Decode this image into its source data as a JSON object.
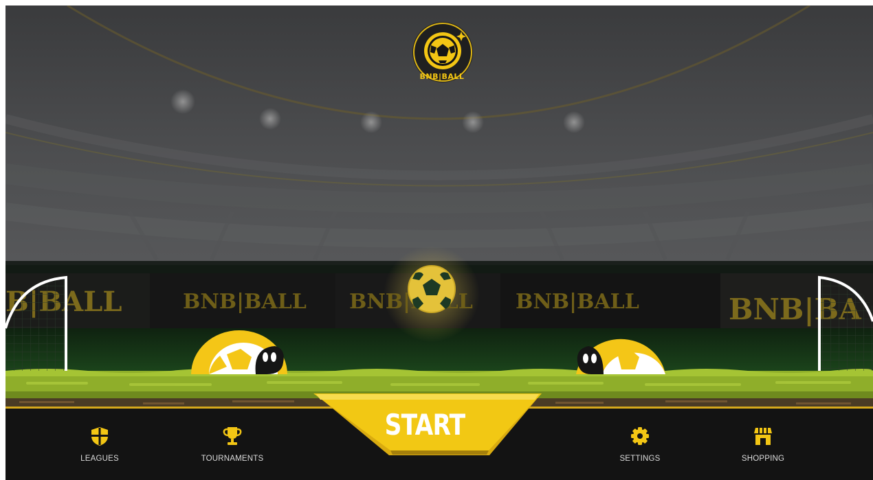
{
  "logo": {
    "text": "BNB|BALL",
    "icon": "soccer-ball-icon"
  },
  "banners": [
    "B|BALL",
    "BNB|BALL",
    "BNB|BALL",
    "BNB|BALL",
    "BNB|BA"
  ],
  "start_button": {
    "label": "START"
  },
  "nav": {
    "leagues": {
      "label": "LEAGUES",
      "icon": "shield-icon"
    },
    "tournaments": {
      "label": "TOURNAMENTS",
      "icon": "trophy-icon"
    },
    "settings": {
      "label": "SETTINGS",
      "icon": "gear-icon"
    },
    "shopping": {
      "label": "SHOPPING",
      "icon": "shop-icon"
    }
  },
  "colors": {
    "accent": "#f3c614",
    "bar": "#131313",
    "grass": "#8fae2a",
    "sky": "#3f4042"
  }
}
